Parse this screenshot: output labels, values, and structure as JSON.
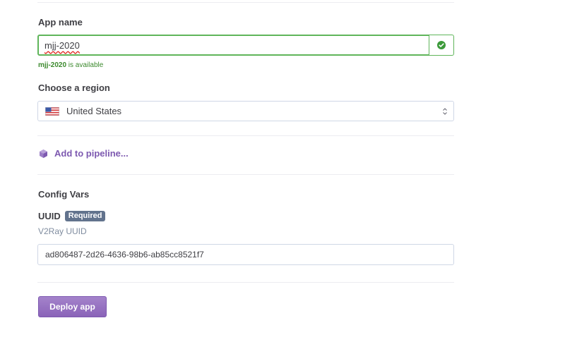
{
  "app_name": {
    "label": "App name",
    "value": "mjj-2020",
    "availability_name": "mjj-2020",
    "availability_text": " is available"
  },
  "region": {
    "label": "Choose a region",
    "selected": "United States",
    "flag_icon": "us-flag-icon"
  },
  "pipeline": {
    "link_text": "Add to pipeline..."
  },
  "config_vars": {
    "heading": "Config Vars",
    "vars": [
      {
        "key": "UUID",
        "badge": "Required",
        "description": "V2Ray UUID",
        "value": "ad806487-2d26-4636-98b6-ab85cc8521f7"
      }
    ]
  },
  "actions": {
    "deploy_label": "Deploy app"
  },
  "colors": {
    "accent": "#7d59b0",
    "success": "#5fb55a",
    "badge": "#62738d"
  }
}
